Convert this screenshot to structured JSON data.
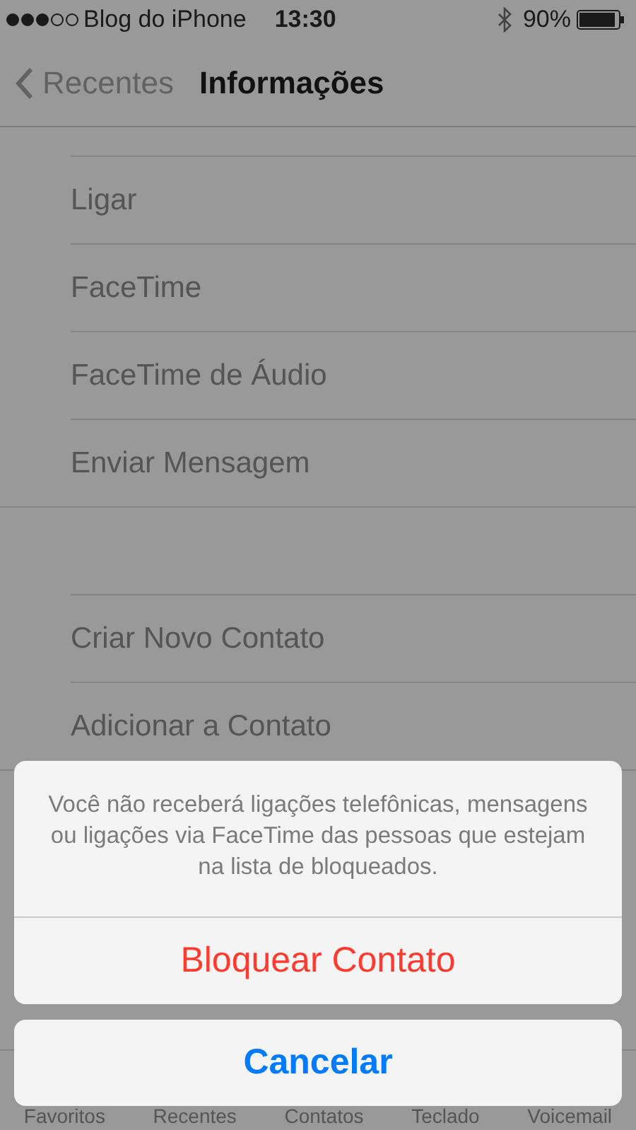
{
  "status_bar": {
    "carrier": "Blog do iPhone",
    "time": "13:30",
    "battery": "90%"
  },
  "nav": {
    "back": "Recentes",
    "title": "Informações"
  },
  "sections": [
    {
      "items": [
        "Ligar",
        "FaceTime",
        "FaceTime de Áudio",
        "Enviar Mensagem"
      ]
    },
    {
      "items": [
        "Criar Novo Contato",
        "Adicionar a Contato"
      ]
    }
  ],
  "tab_bar": [
    "Favoritos",
    "Recentes",
    "Contatos",
    "Teclado",
    "Voicemail"
  ],
  "action_sheet": {
    "message": "Você não receberá ligações telefônicas, mensagens ou ligações via FaceTime das pessoas que estejam na lista de bloqueados.",
    "actions": [
      {
        "label": "Bloquear Contato",
        "kind": "destructive"
      },
      {
        "label": "Cancelar",
        "kind": "cancel"
      }
    ]
  }
}
